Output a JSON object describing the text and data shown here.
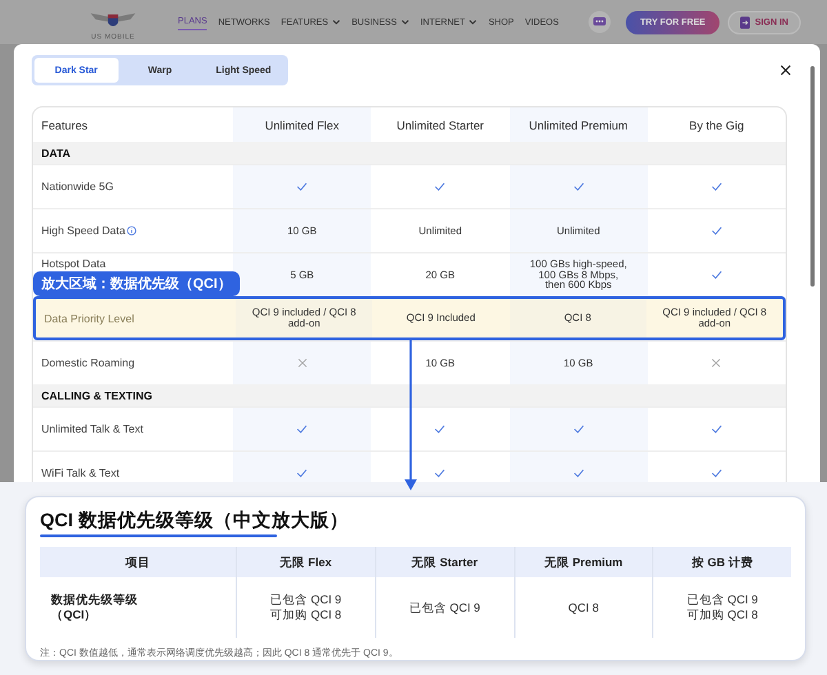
{
  "nav": {
    "logo_text": "US MOBILE",
    "items": [
      {
        "label": "PLANS",
        "selected": true,
        "dropdown": false
      },
      {
        "label": "NETWORKS",
        "selected": false,
        "dropdown": false
      },
      {
        "label": "FEATURES",
        "selected": false,
        "dropdown": true
      },
      {
        "label": "BUSINESS",
        "selected": false,
        "dropdown": true
      },
      {
        "label": "INTERNET",
        "selected": false,
        "dropdown": true
      },
      {
        "label": "SHOP",
        "selected": false,
        "dropdown": false
      },
      {
        "label": "VIDEOS",
        "selected": false,
        "dropdown": false
      }
    ],
    "try_button": "TRY FOR FREE",
    "sign_in_button": "SIGN IN"
  },
  "modal": {
    "tabs": [
      {
        "label": "Dark Star",
        "selected": true
      },
      {
        "label": "Warp",
        "selected": false
      },
      {
        "label": "Light Speed",
        "selected": false
      }
    ],
    "table": {
      "columns": [
        "Features",
        "Unlimited Flex",
        "Unlimited Starter",
        "Unlimited Premium",
        "By the Gig"
      ],
      "sections": [
        {
          "title": "DATA",
          "rows": [
            {
              "feature": "Nationwide 5G",
              "info": false,
              "highlighted": false,
              "cells": [
                {
                  "kind": "check"
                },
                {
                  "kind": "check"
                },
                {
                  "kind": "check"
                },
                {
                  "kind": "check"
                }
              ]
            },
            {
              "feature": "High Speed Data",
              "info": true,
              "highlighted": false,
              "cells": [
                {
                  "kind": "text",
                  "lines": [
                    "10 GB"
                  ]
                },
                {
                  "kind": "text",
                  "lines": [
                    "Unlimited"
                  ]
                },
                {
                  "kind": "text",
                  "lines": [
                    "Unlimited"
                  ]
                },
                {
                  "kind": "check"
                }
              ]
            },
            {
              "feature": "Hotspot Data",
              "info": false,
              "highlighted": false,
              "cells": [
                {
                  "kind": "text",
                  "lines": [
                    "5 GB"
                  ]
                },
                {
                  "kind": "text",
                  "lines": [
                    "20 GB"
                  ]
                },
                {
                  "kind": "text",
                  "lines": [
                    "100 GBs high-speed,",
                    "100 GBs 8 Mbps,",
                    "then 600 Kbps"
                  ]
                },
                {
                  "kind": "check"
                }
              ]
            },
            {
              "feature": "Data Priority Level",
              "info": false,
              "highlighted": true,
              "cells": [
                {
                  "kind": "text",
                  "lines": [
                    "QCI 9 included / QCI 8",
                    "add-on"
                  ]
                },
                {
                  "kind": "text",
                  "lines": [
                    "QCI 9 Included"
                  ]
                },
                {
                  "kind": "text",
                  "lines": [
                    "QCI 8"
                  ]
                },
                {
                  "kind": "text",
                  "lines": [
                    "QCI 9 included / QCI 8",
                    "add-on"
                  ]
                }
              ]
            },
            {
              "feature": "Domestic Roaming",
              "info": false,
              "highlighted": false,
              "cells": [
                {
                  "kind": "cross"
                },
                {
                  "kind": "text",
                  "lines": [
                    "10 GB"
                  ]
                },
                {
                  "kind": "text",
                  "lines": [
                    "10 GB"
                  ]
                },
                {
                  "kind": "cross"
                }
              ]
            }
          ]
        },
        {
          "title": "CALLING & TEXTING",
          "rows": [
            {
              "feature": "Unlimited Talk & Text",
              "info": false,
              "highlighted": false,
              "cells": [
                {
                  "kind": "check"
                },
                {
                  "kind": "check"
                },
                {
                  "kind": "check"
                },
                {
                  "kind": "check"
                }
              ]
            },
            {
              "feature": "WiFi Talk & Text",
              "info": false,
              "highlighted": false,
              "cells": [
                {
                  "kind": "check"
                },
                {
                  "kind": "check"
                },
                {
                  "kind": "check"
                },
                {
                  "kind": "check"
                }
              ]
            }
          ]
        }
      ]
    }
  },
  "callout": {
    "label": "放大区域：数据优先级（QCI）"
  },
  "zoom_panel": {
    "title": "QCI 数据优先级等级（中文放大版）",
    "columns": [
      "项目",
      "无限 Flex",
      "无限 Starter",
      "无限 Premium",
      "按 GB 计费"
    ],
    "rows": [
      {
        "cells": [
          [
            "数据优先级等级",
            "（QCI）"
          ],
          [
            "已包含 QCI 9",
            "可加购 QCI 8"
          ],
          [
            "已包含 QCI 9"
          ],
          [
            "QCI 8"
          ],
          [
            "已包含 QCI 9",
            "可加购 QCI 8"
          ]
        ]
      }
    ],
    "note": "注：QCI 数值越低，通常表示网络调度优先级越高；因此 QCI 8 通常优先于 QCI 9。"
  }
}
